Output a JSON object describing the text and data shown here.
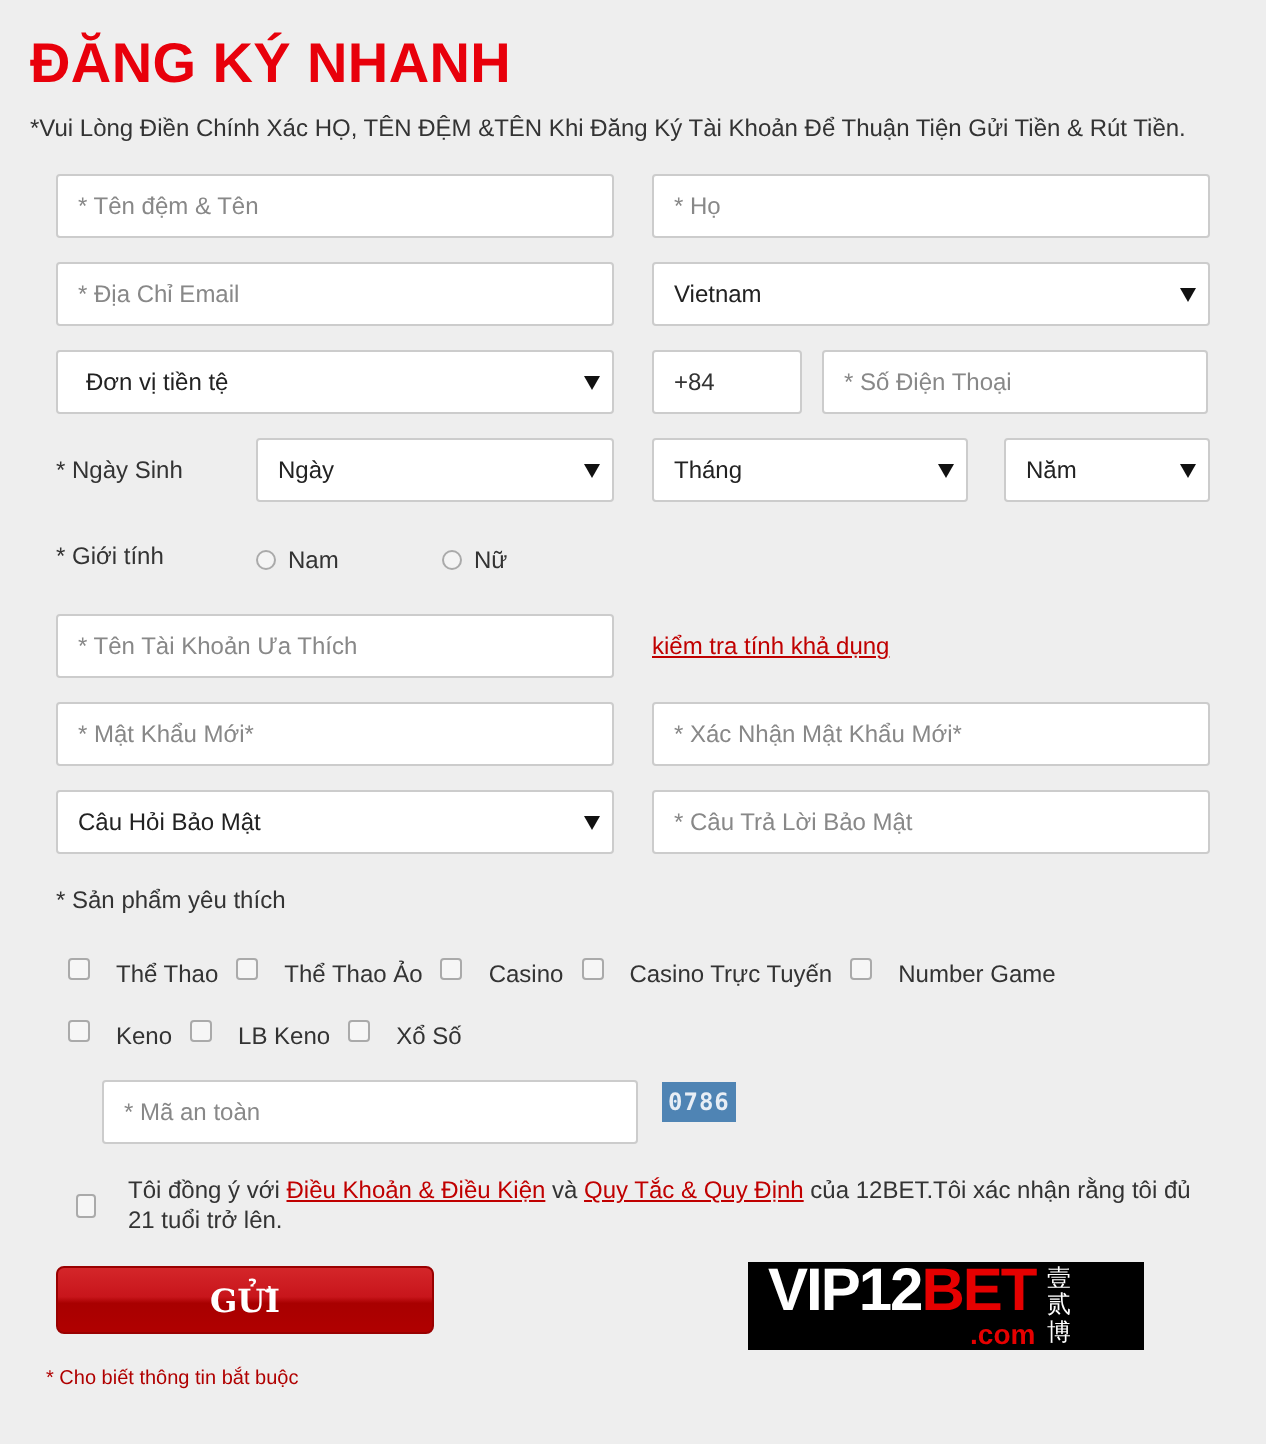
{
  "title": "ĐĂNG KÝ NHANH",
  "notice": "*Vui Lòng Điền Chính Xác HỌ, TÊN ĐỆM &TÊN Khi Đăng Ký Tài Khoản Để Thuận Tiện Gửi Tiền & Rút Tiền.",
  "name_fields": [
    {
      "placeholder": "* Tên đệm & Tên"
    },
    {
      "placeholder": "* Họ"
    }
  ],
  "email": {
    "placeholder": "* Địa Chỉ Email"
  },
  "country": {
    "value": "Vietnam"
  },
  "currency": {
    "value": "Đơn vị tiền tệ"
  },
  "phone_code": {
    "value": "+84"
  },
  "phone": {
    "placeholder": "* Số Điện Thoại"
  },
  "birthday": {
    "label": "* Ngày Sinh",
    "selects": [
      "Ngày",
      "Tháng",
      "Năm"
    ]
  },
  "gender": {
    "label": "* Giới tính",
    "options": [
      {
        "label": "Nam",
        "selected": false
      },
      {
        "label": "Nữ",
        "selected": false
      }
    ]
  },
  "username": {
    "placeholder": "* Tên Tài Khoản Ưa Thích",
    "check_link": "kiểm tra tính khả dụng"
  },
  "passwords": [
    {
      "placeholder": "* Mật Khẩu Mới*"
    },
    {
      "placeholder": "* Xác Nhận Mật Khẩu Mới*"
    }
  ],
  "security": {
    "question": "Câu Hỏi Bảo Mật",
    "answer_placeholder": "* Câu Trả Lời Bảo Mật"
  },
  "products": {
    "label": "* Sản phẩm yêu thích",
    "items": [
      {
        "label": "Thể Thao",
        "checked": false
      },
      {
        "label": "Thể Thao Ảo",
        "checked": false
      },
      {
        "label": "Casino",
        "checked": false
      },
      {
        "label": "Casino Trực Tuyến",
        "checked": false
      },
      {
        "label": "Number Game",
        "checked": false
      },
      {
        "label": "Keno",
        "checked": false
      },
      {
        "label": "LB Keno",
        "checked": false
      },
      {
        "label": "Xổ Số",
        "checked": false
      }
    ]
  },
  "captcha": {
    "placeholder": "* Mã an toàn",
    "code": "0786"
  },
  "agreement": {
    "checked": false,
    "parts": [
      {
        "kind": "text",
        "text": "Tôi đồng ý với "
      },
      {
        "kind": "link",
        "text": "Điều Khoản & Điều Kiện"
      },
      {
        "kind": "text",
        "text": " và "
      },
      {
        "kind": "link",
        "text": "Quy Tắc & Quy Định"
      },
      {
        "kind": "text",
        "text": " của 12BET.Tôi xác nhận rằng tôi đủ 21 tuổi trở lên."
      }
    ]
  },
  "submit": "GỬI",
  "logo": {
    "prefix": "VIP12",
    "suffix": "BET",
    "domain": ".com",
    "side_text": "壹贰博"
  },
  "required_note": "* Cho biết thông tin bắt buộc"
}
